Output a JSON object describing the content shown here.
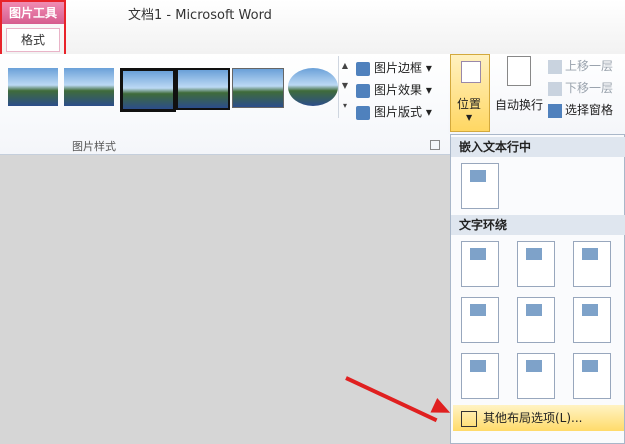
{
  "title": {
    "tools_head": "图片工具",
    "tools_tab": "格式",
    "doc_title": "文档1 - Microsoft Word"
  },
  "ribbon": {
    "group_label": "图片样式",
    "commands": [
      "图片边框",
      "图片效果",
      "图片版式"
    ],
    "position_label": "位置",
    "wrap_label": "自动换行",
    "order": [
      "上移一层",
      "下移一层",
      "选择窗格"
    ]
  },
  "dropdown": {
    "section_inline": "嵌入文本行中",
    "section_wrap": "文字环绕",
    "more_options": "其他布局选项(L)..."
  },
  "colors": {
    "accent_pink": "#d65c8e",
    "highlight": "#ffd763",
    "annotation_red": "#e02020"
  }
}
